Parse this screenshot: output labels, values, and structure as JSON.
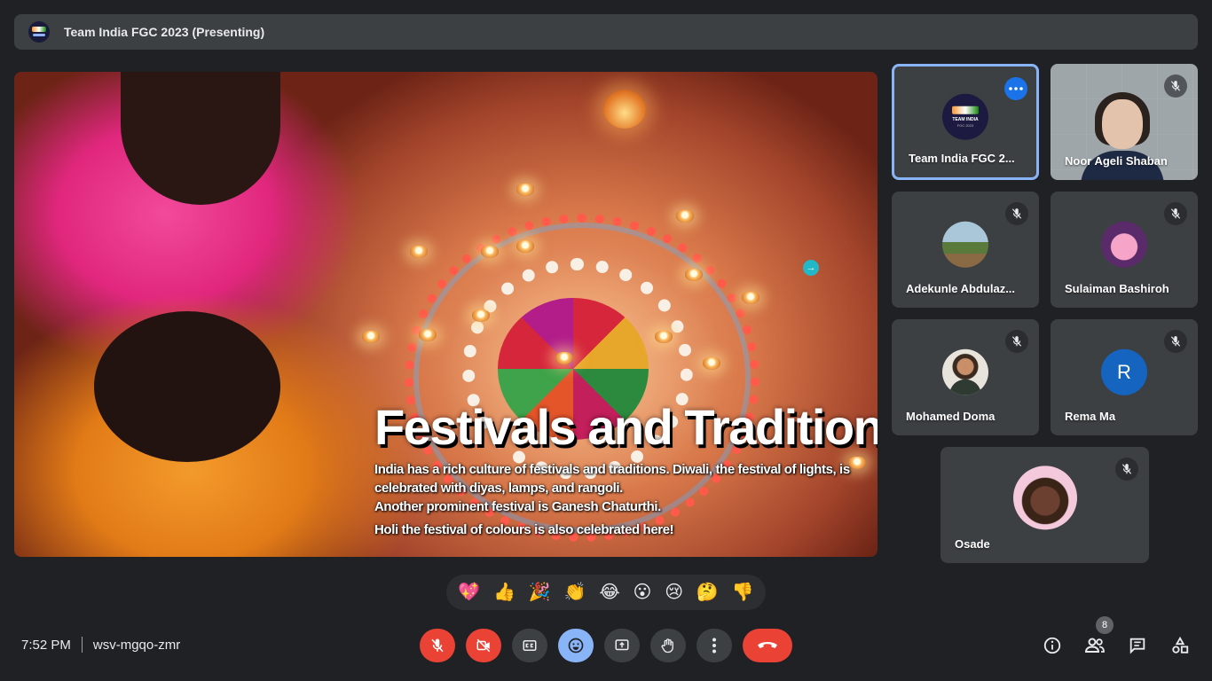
{
  "meeting": {
    "title": "Team India FGC 2023 (Presenting)",
    "time": "7:52 PM",
    "code": "wsv-mgqo-zmr"
  },
  "slide": {
    "heading": "Festivals and Traditions",
    "lines": [
      "India has a rich culture of festivals and traditions. Diwali, the festival of lights, is celebrated with diyas, lamps, and rangoli.",
      "Another prominent festival is Ganesh Chaturthi.",
      "Holi the festival of colours is also celebrated here!"
    ]
  },
  "participants": [
    {
      "name": "Team India FGC 2...",
      "avatar": "team-india-logo",
      "active": true
    },
    {
      "name": "Noor Ageli Shaban",
      "avatar": "video-feed"
    },
    {
      "name": "Adekunle Abdulaz...",
      "avatar": "photo-field"
    },
    {
      "name": "Sulaiman Bashiroh",
      "avatar": "photo-cartoon"
    },
    {
      "name": "Mohamed Doma",
      "avatar": "photo-person"
    },
    {
      "name": "Rema Ma",
      "avatar": "letter",
      "initial": "R",
      "color": "#1565c0"
    },
    {
      "name": "Osade",
      "avatar": "photo-cartoon-princess"
    }
  ],
  "team_logo": {
    "line1": "TEAM INDIA",
    "line2": "FGC 2023"
  },
  "reactions": [
    "💖",
    "👍",
    "🎉",
    "👏",
    "😂",
    "😮",
    "😢",
    "🤔",
    "👎"
  ],
  "controls": [
    "mic-off",
    "camera-off",
    "captions",
    "emoji",
    "present",
    "raise-hand",
    "more-options",
    "leave-call"
  ],
  "side_controls": {
    "people_count": "8",
    "icons": [
      "info-icon",
      "people-icon",
      "chat-icon",
      "activities-icon"
    ]
  },
  "colors": {
    "background": "#202124",
    "tile": "#3c4043",
    "active_border": "#8ab4f8",
    "danger": "#ea4335",
    "accent": "#8ab4f8"
  }
}
